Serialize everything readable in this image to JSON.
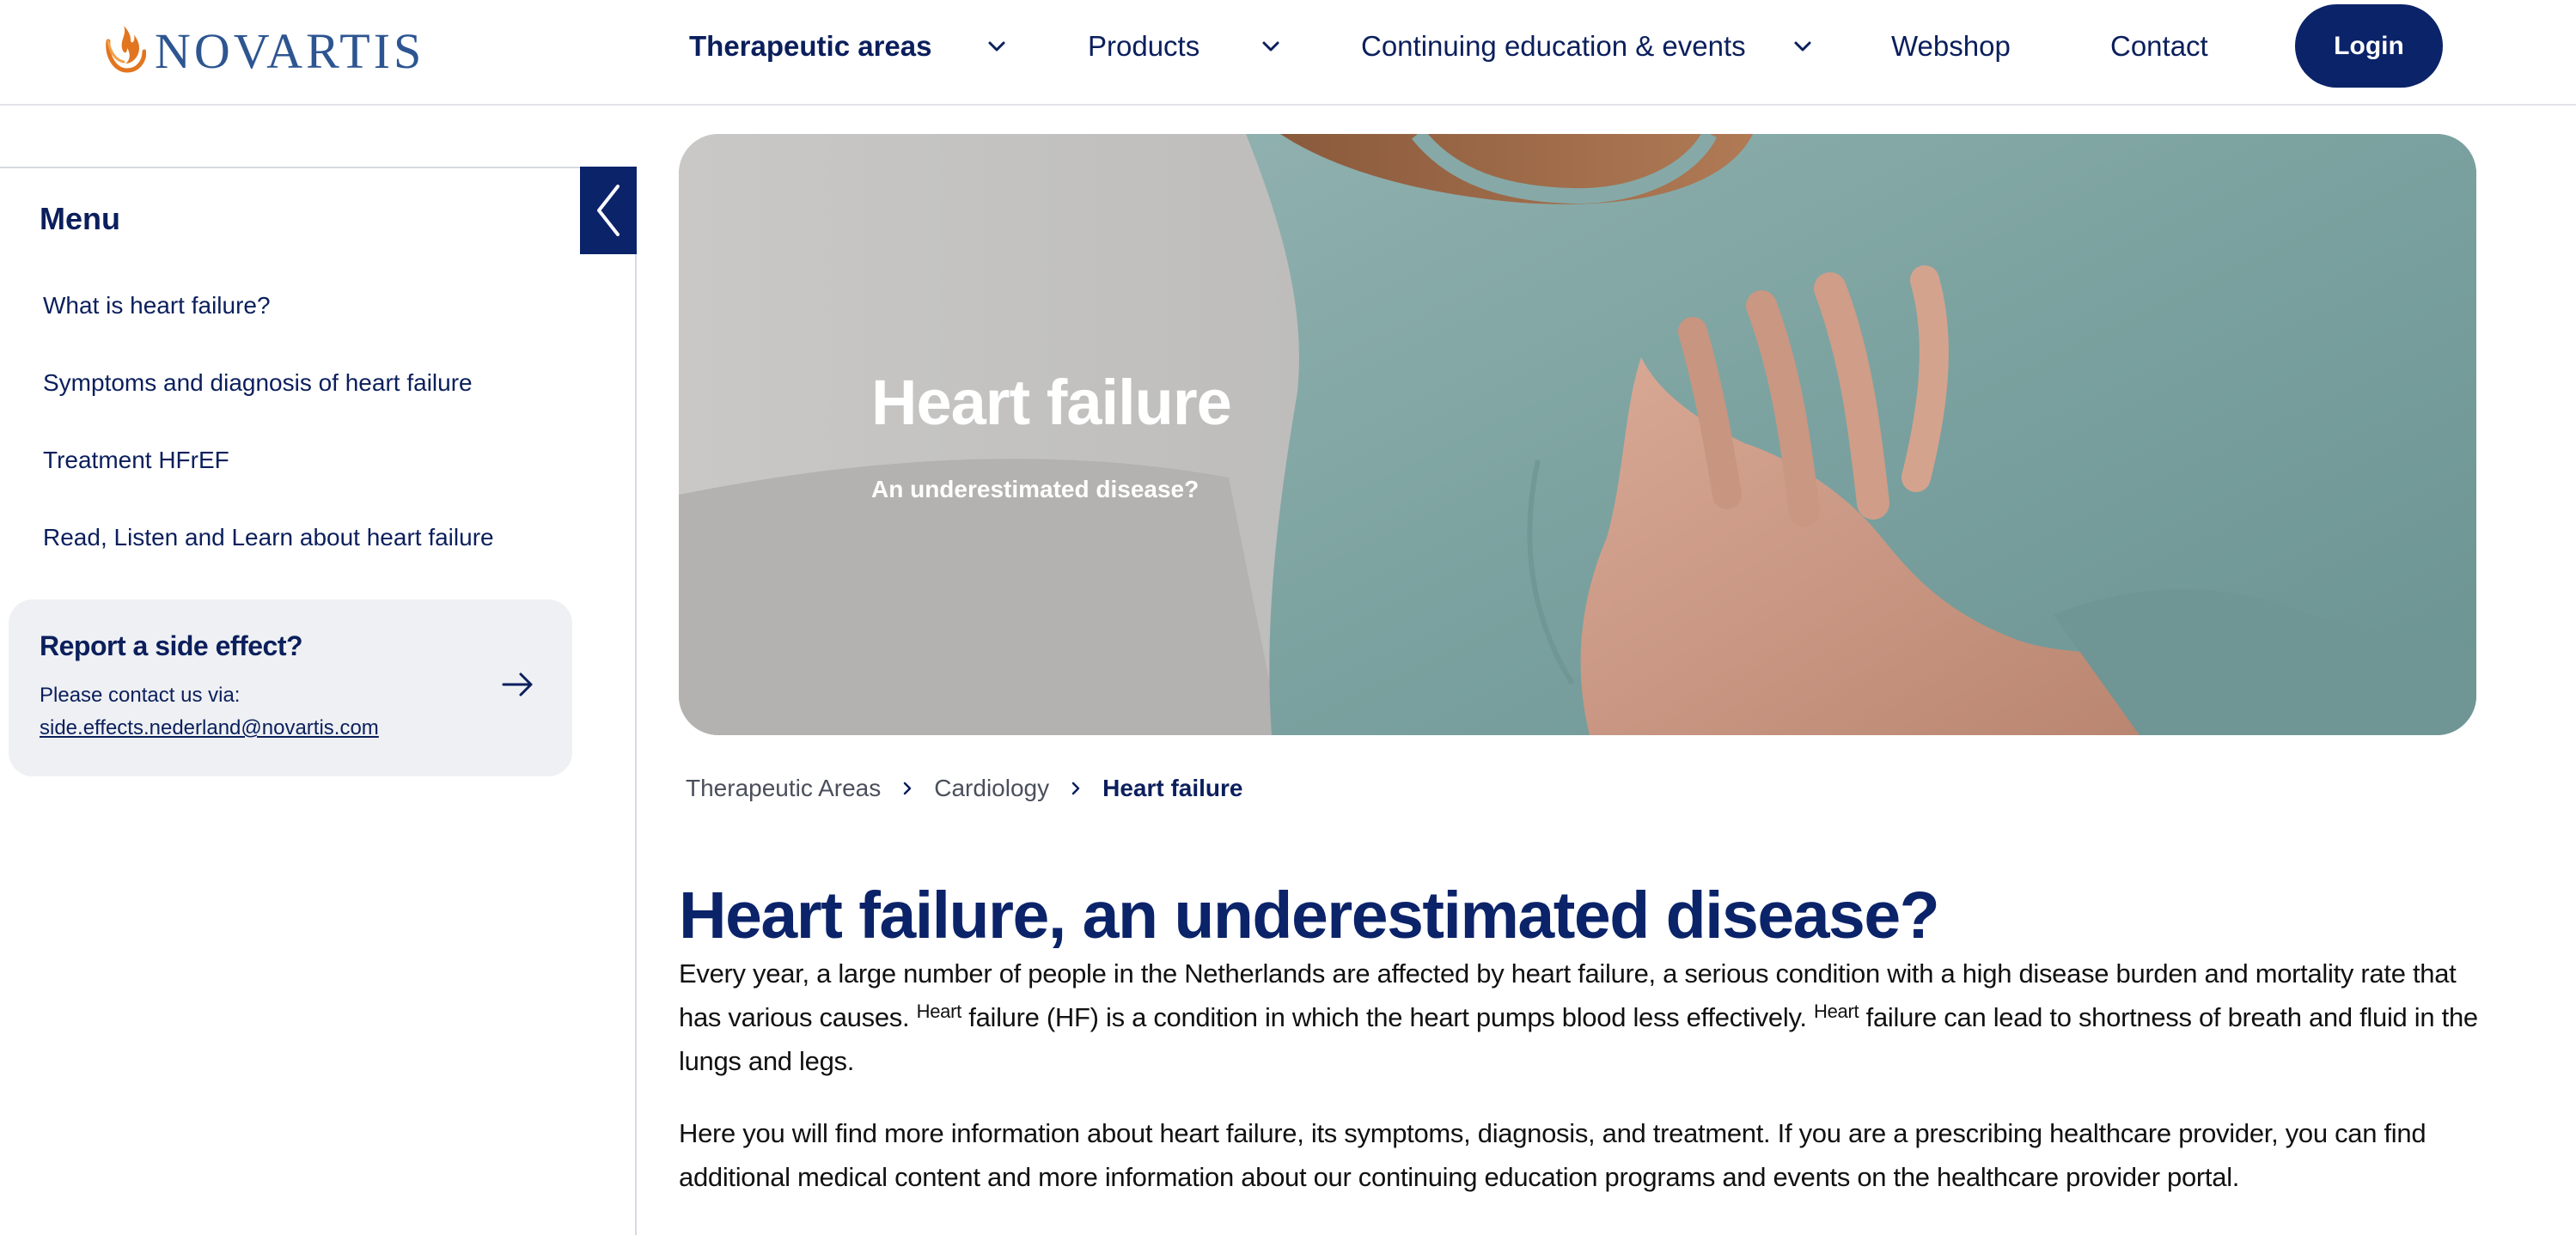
{
  "header": {
    "logo_text": "NOVARTIS",
    "nav": [
      {
        "label": "Therapeutic areas",
        "has_dropdown": true
      },
      {
        "label": "Products",
        "has_dropdown": true
      },
      {
        "label": "Continuing education & events",
        "has_dropdown": true
      },
      {
        "label": "Webshop",
        "has_dropdown": false
      },
      {
        "label": "Contact",
        "has_dropdown": false
      }
    ],
    "login_label": "Login"
  },
  "sidebar": {
    "title": "Menu",
    "collapse_icon": "chevron-left-icon",
    "items": [
      {
        "label": "What is heart failure?"
      },
      {
        "label": "Symptoms and diagnosis of heart failure"
      },
      {
        "label": "Treatment HFrEF"
      },
      {
        "label": "Read, Listen and Learn about heart failure"
      }
    ],
    "report": {
      "title": "Report a side effect?",
      "text": "Please contact us via:",
      "email": "side.effects.nederland@novartis.com",
      "arrow_icon": "arrow-right-icon"
    }
  },
  "hero": {
    "title": "Heart failure",
    "subtitle": "An underestimated disease?"
  },
  "breadcrumb": [
    "Therapeutic Areas",
    "Cardiology",
    "Heart failure"
  ],
  "article": {
    "title": "Heart failure, an underestimated disease?",
    "p1": {
      "part1": "Every year, a large number of people in the Netherlands are affected by heart failure, a serious condition with a high disease burden and mortality rate that has various causes.",
      "sup1": "Heart",
      "part2": "failure (HF) is a condition in which the heart pumps blood less effectively.",
      "sup2": "Heart",
      "part3": "failure can lead to shortness of breath and fluid in the lungs and legs."
    },
    "p2": "Here you will find more information about heart failure, its symptoms, diagnosis, and treatment. If you are a prescribing healthcare provider, you can find additional medical content and more information about our continuing education programs and events on the healthcare provider portal."
  },
  "colors": {
    "brand_navy": "#0b2369",
    "text_navy": "#0b1f5c",
    "logo_blue": "#2d5591",
    "logo_orange": "#e2751f",
    "card_bg": "#eef0f3"
  }
}
